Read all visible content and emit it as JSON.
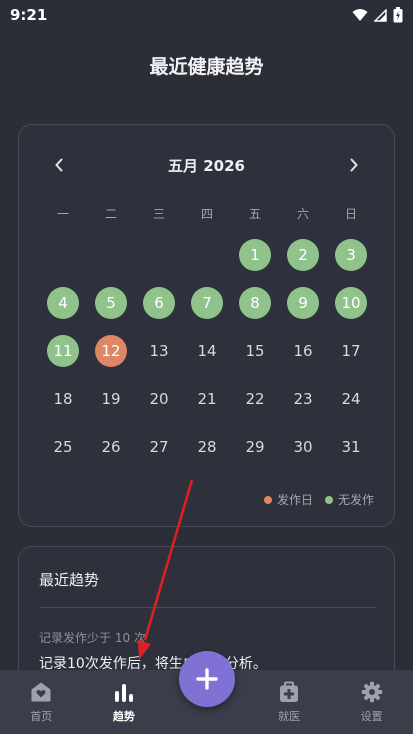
{
  "status_bar": {
    "time": "9:21"
  },
  "page_title": "最近健康趋势",
  "calendar": {
    "title": "五月 2026",
    "weekdays": [
      "一",
      "二",
      "三",
      "四",
      "五",
      "六",
      "日"
    ],
    "leading_blanks": 4,
    "days": [
      {
        "num": "1",
        "state": "ok"
      },
      {
        "num": "2",
        "state": "ok"
      },
      {
        "num": "3",
        "state": "ok"
      },
      {
        "num": "4",
        "state": "ok"
      },
      {
        "num": "5",
        "state": "ok"
      },
      {
        "num": "6",
        "state": "ok"
      },
      {
        "num": "7",
        "state": "ok"
      },
      {
        "num": "8",
        "state": "ok"
      },
      {
        "num": "9",
        "state": "ok"
      },
      {
        "num": "10",
        "state": "ok"
      },
      {
        "num": "11",
        "state": "ok"
      },
      {
        "num": "12",
        "state": "attack"
      },
      {
        "num": "13",
        "state": "none"
      },
      {
        "num": "14",
        "state": "none"
      },
      {
        "num": "15",
        "state": "none"
      },
      {
        "num": "16",
        "state": "none"
      },
      {
        "num": "17",
        "state": "none"
      },
      {
        "num": "18",
        "state": "none"
      },
      {
        "num": "19",
        "state": "none"
      },
      {
        "num": "20",
        "state": "none"
      },
      {
        "num": "21",
        "state": "none"
      },
      {
        "num": "22",
        "state": "none"
      },
      {
        "num": "23",
        "state": "none"
      },
      {
        "num": "24",
        "state": "none"
      },
      {
        "num": "25",
        "state": "none"
      },
      {
        "num": "26",
        "state": "none"
      },
      {
        "num": "27",
        "state": "none"
      },
      {
        "num": "28",
        "state": "none"
      },
      {
        "num": "29",
        "state": "none"
      },
      {
        "num": "30",
        "state": "none"
      },
      {
        "num": "31",
        "state": "none"
      }
    ],
    "legend": {
      "attack_label": "发作日",
      "ok_label": "无发作"
    }
  },
  "colors": {
    "attack": "#dc8765",
    "ok": "#8fc38b",
    "accent": "#7f72d4",
    "annotation_arrow": "#e02020"
  },
  "trend": {
    "title": "最近趋势",
    "hint": "记录发作少于 10 次",
    "description": "记录10次发作后，将生成趋势分析。"
  },
  "bottom_nav": {
    "items": [
      {
        "label": "首页",
        "icon": "home-heart-icon"
      },
      {
        "label": "趋势",
        "icon": "bar-chart-icon"
      },
      {
        "label": "就医",
        "icon": "medical-kit-icon"
      },
      {
        "label": "设置",
        "icon": "gear-icon"
      }
    ],
    "fab_icon": "plus-icon"
  }
}
